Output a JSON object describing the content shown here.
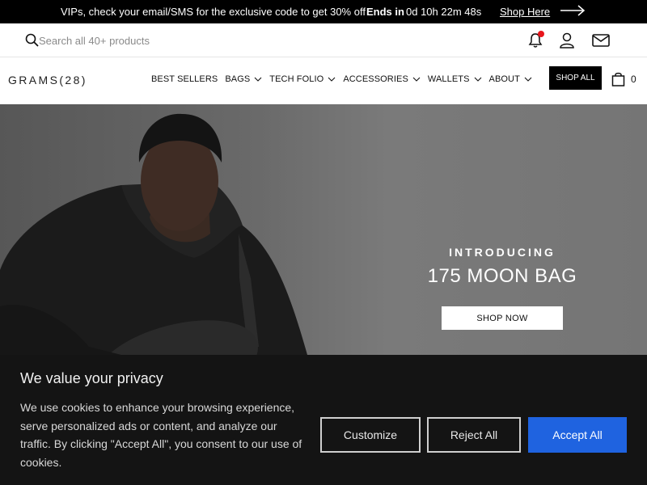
{
  "promo": {
    "message": "VIPs, check your email/SMS for the exclusive code to get 30% off",
    "ends_label": "Ends in",
    "timer": "0d 10h 22m 48s",
    "link": "Shop Here"
  },
  "search": {
    "placeholder": "Search all 40+ products"
  },
  "header": {
    "logo": "GRAMS(28)",
    "nav": [
      {
        "label": "BEST SELLERS"
      },
      {
        "label": "BAGS"
      },
      {
        "label": "TECH FOLIO"
      },
      {
        "label": "ACCESSORIES"
      },
      {
        "label": "WALLETS"
      },
      {
        "label": "ABOUT"
      }
    ],
    "shop_all": "SHOP ALL",
    "cart_count": "0"
  },
  "hero": {
    "eyebrow": "INTRODUCING",
    "headline": "175 MOON BAG",
    "cta": "SHOP NOW"
  },
  "cookie": {
    "title": "We value your privacy",
    "body": "We use cookies to enhance your browsing experience, serve personalized ads or content, and analyze our traffic. By clicking \"Accept All\", you consent to our use of cookies.",
    "customize": "Customize",
    "reject": "Reject All",
    "accept": "Accept All"
  },
  "colors": {
    "accent": "#1f63e0",
    "notification": "#e8151b"
  }
}
